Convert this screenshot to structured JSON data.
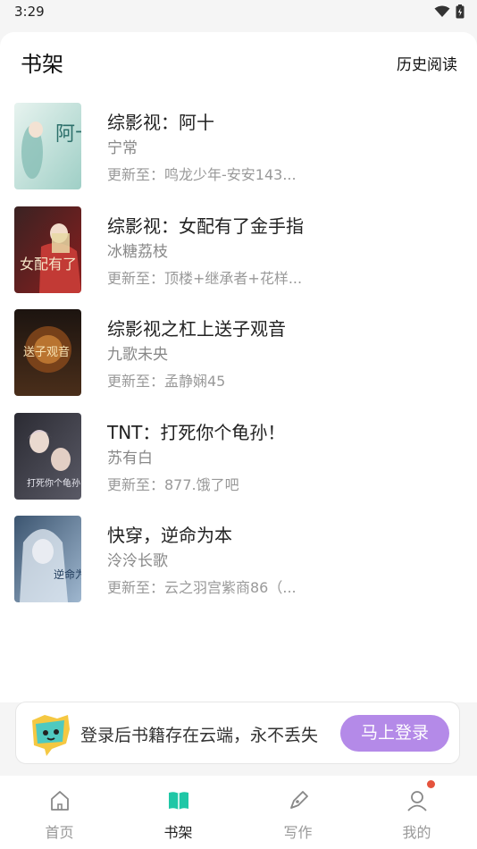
{
  "status": {
    "time": "3:29"
  },
  "header": {
    "title": "书架",
    "history": "历史阅读"
  },
  "books": [
    {
      "title": "综影视：阿十",
      "author": "宁常",
      "update": "更新至：鸣龙少年-安安143...",
      "cover_title": "阿十"
    },
    {
      "title": "综影视：女配有了金手指",
      "author": "冰糖荔枝",
      "update": "更新至：顶楼+继承者+花样...",
      "cover_title": "女配有了"
    },
    {
      "title": "综影视之杠上送子观音",
      "author": "九歌未央",
      "update": "更新至：孟静娴45",
      "cover_title": "送子观音"
    },
    {
      "title": "TNT：打死你个龟孙！",
      "author": "苏有白",
      "update": "更新至：877.饿了吧",
      "cover_title": "打死你个龟孙"
    },
    {
      "title": "快穿，逆命为本",
      "author": "泠泠长歌",
      "update": "更新至：云之羽宫紫商86（...",
      "cover_title": "逆命为本"
    }
  ],
  "login": {
    "text": "登录后书籍存在云端，永不丢失",
    "button": "马上登录"
  },
  "tabs": [
    {
      "label": "首页",
      "icon": "home-icon",
      "active": false
    },
    {
      "label": "书架",
      "icon": "bookshelf-icon",
      "active": true
    },
    {
      "label": "写作",
      "icon": "pen-icon",
      "active": false
    },
    {
      "label": "我的",
      "icon": "profile-icon",
      "active": false
    }
  ],
  "colors": {
    "accent": "#1fc7a6",
    "login_button": "#b48ae8",
    "badge": "#e5533d"
  }
}
